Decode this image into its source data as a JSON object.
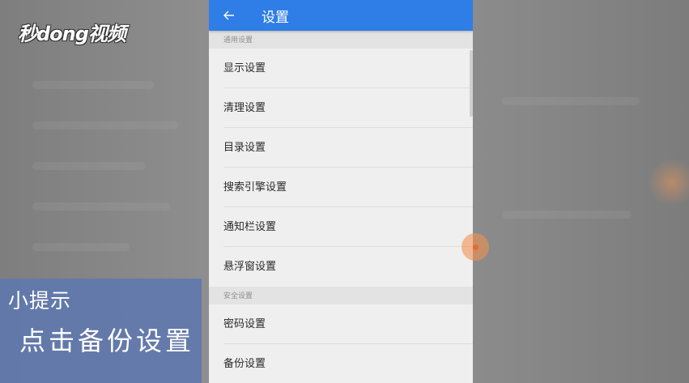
{
  "watermark": {
    "logo_text": "秒dong视频"
  },
  "appbar": {
    "title": "设置",
    "back_icon": "arrow-left-icon"
  },
  "sections": [
    {
      "header": "通用设置",
      "items": [
        "显示设置",
        "清理设置",
        "目录设置",
        "搜索引擎设置",
        "通知栏设置",
        "悬浮窗设置"
      ]
    },
    {
      "header": "安全设置",
      "items": [
        "密码设置",
        "备份设置"
      ]
    }
  ],
  "tip": {
    "title": "小提示",
    "text": "点击备份设置"
  },
  "colors": {
    "appbar": "#2f7ee8",
    "tip_box": "#5f78af",
    "float_ball": "#ea6a2a"
  }
}
